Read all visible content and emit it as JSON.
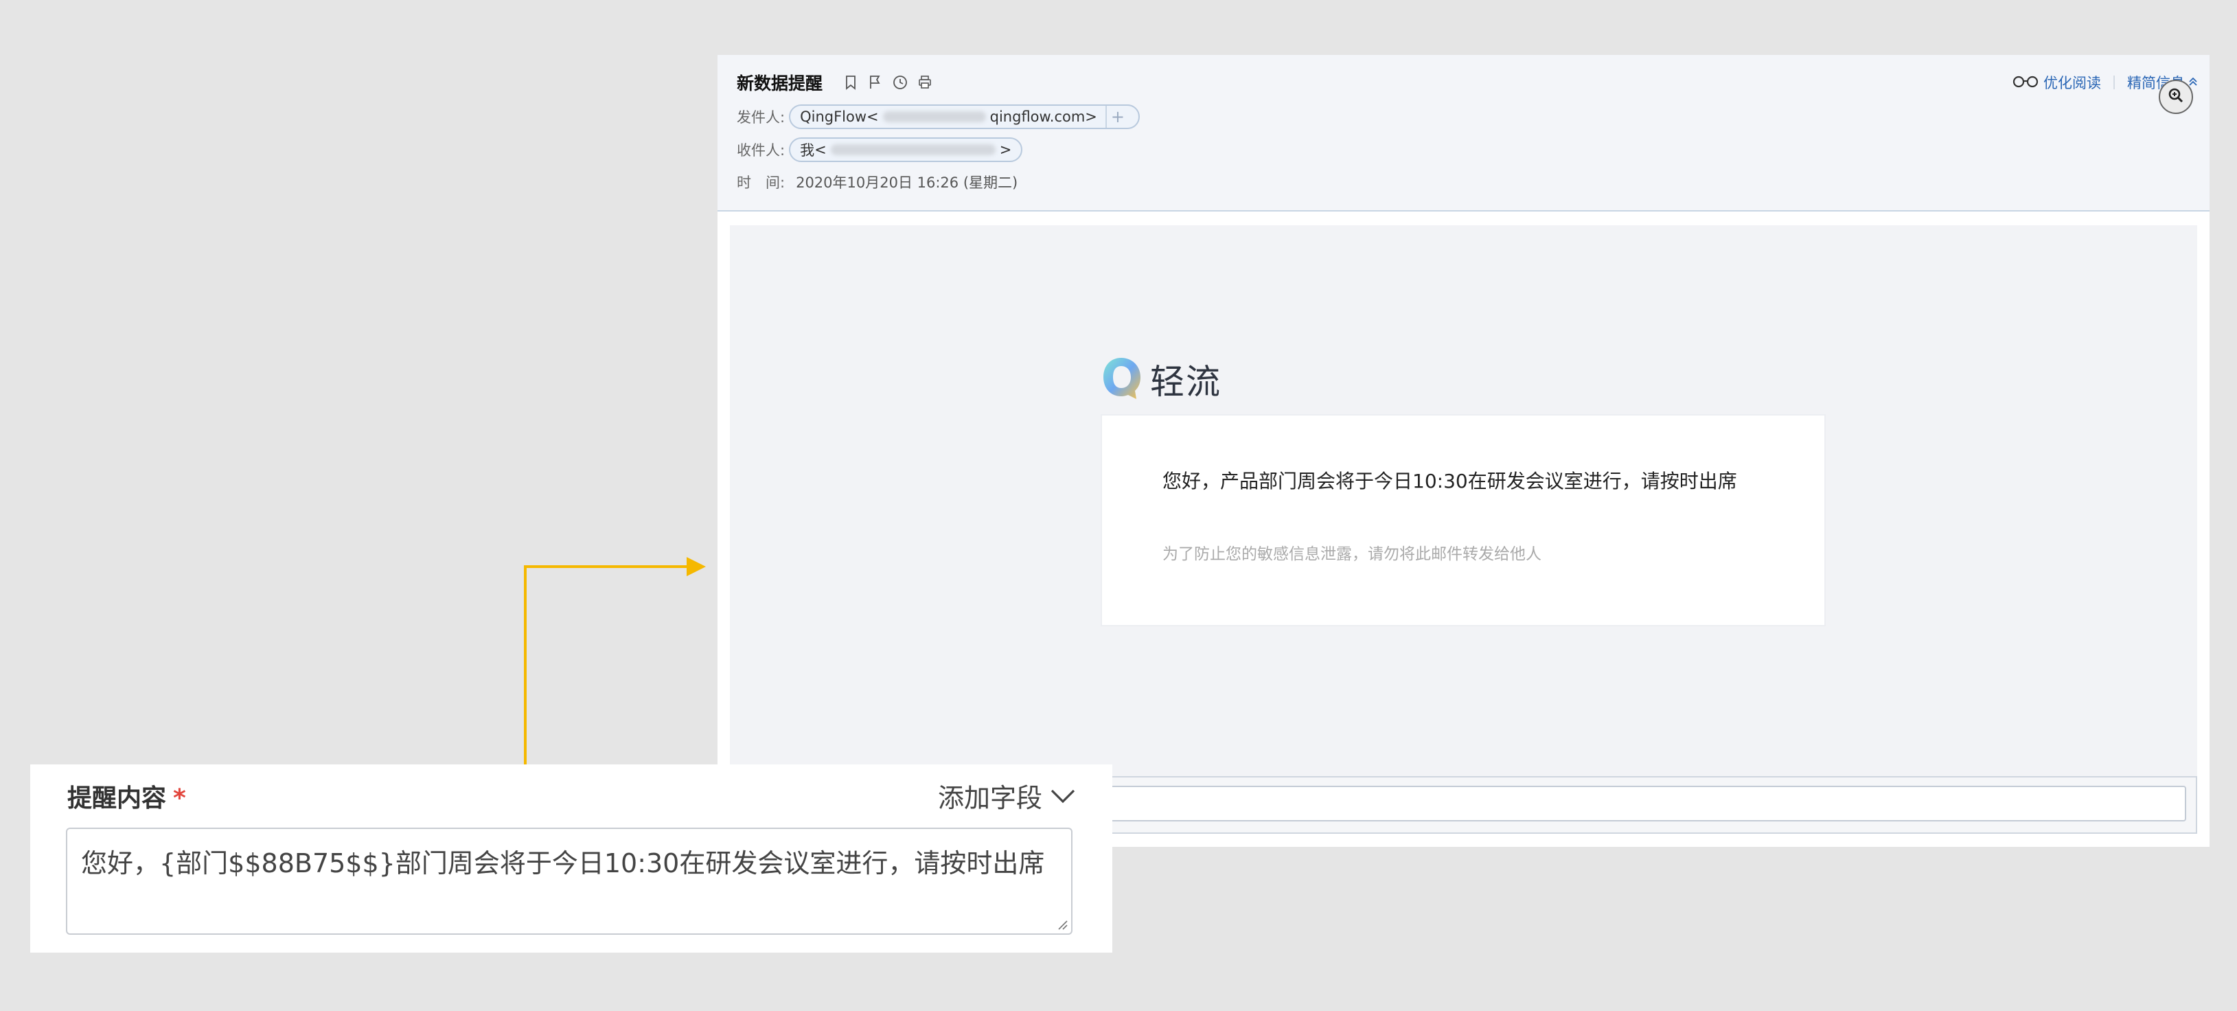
{
  "email": {
    "subject": "新数据提醒",
    "header_actions": {
      "optimize_reading": "优化阅读",
      "concise_info": "精简信息"
    },
    "from": {
      "label": "发件人:",
      "name": "QingFlow",
      "address_prefix": "<",
      "address_domain": "qingflow.com>"
    },
    "to": {
      "label": "收件人:",
      "name": "我",
      "address_prefix": "<",
      "address_suffix": ">"
    },
    "time": {
      "label": "时　间:",
      "value": "2020年10月20日 16:26 (星期二)"
    },
    "body": {
      "brand_name": "轻流",
      "message": "您好，产品部门周会将于今日10:30在研发会议室进行，请按时出席",
      "hint": "为了防止您的敏感信息泄露，请勿将此邮件转发给他人"
    }
  },
  "reminder": {
    "title": "提醒内容",
    "required_mark": "*",
    "add_field_label": "添加字段",
    "content": "您好，{部门$$88B75$$}部门周会将于今日10:30在研发会议室进行，请按时出席"
  },
  "colors": {
    "arrow": "#f5b800",
    "link": "#2a66b5",
    "required": "#e2453c"
  }
}
